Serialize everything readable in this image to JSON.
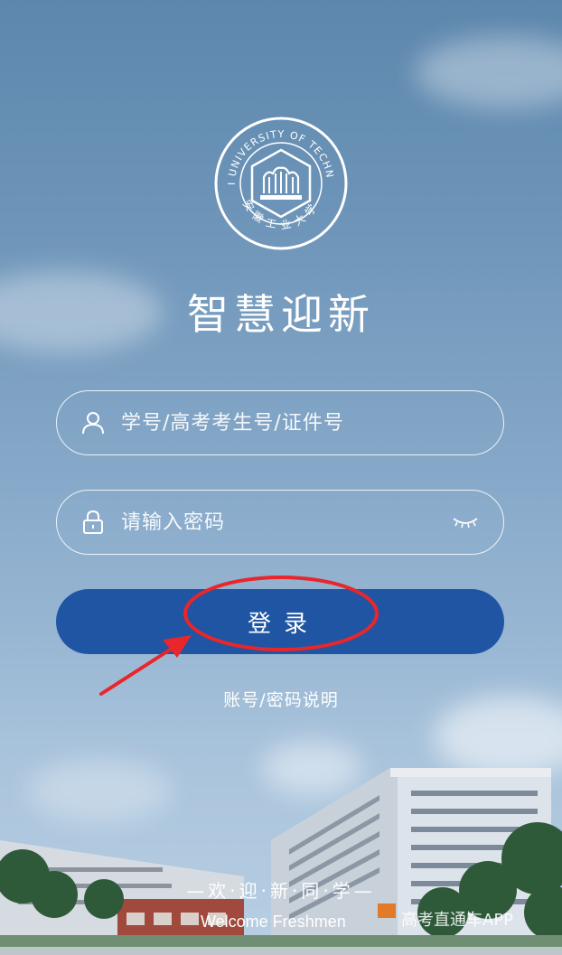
{
  "logo": {
    "arc_text": "ANHUI UNIVERSITY OF TECHNOLOGY",
    "chinese_name": "安徽工业大学"
  },
  "app": {
    "title": "智慧迎新"
  },
  "form": {
    "username_placeholder": "学号/高考考生号/证件号",
    "password_placeholder": "请输入密码",
    "login_label": "登录",
    "help_link": "账号/密码说明"
  },
  "footer": {
    "welcome_cn": "—欢·迎·新·同·学—",
    "welcome_en": "Welcome Freshmen"
  },
  "watermark": "高考直通车APP",
  "colors": {
    "primary_button": "#1f55a3",
    "annotation_red": "#e8262b"
  }
}
